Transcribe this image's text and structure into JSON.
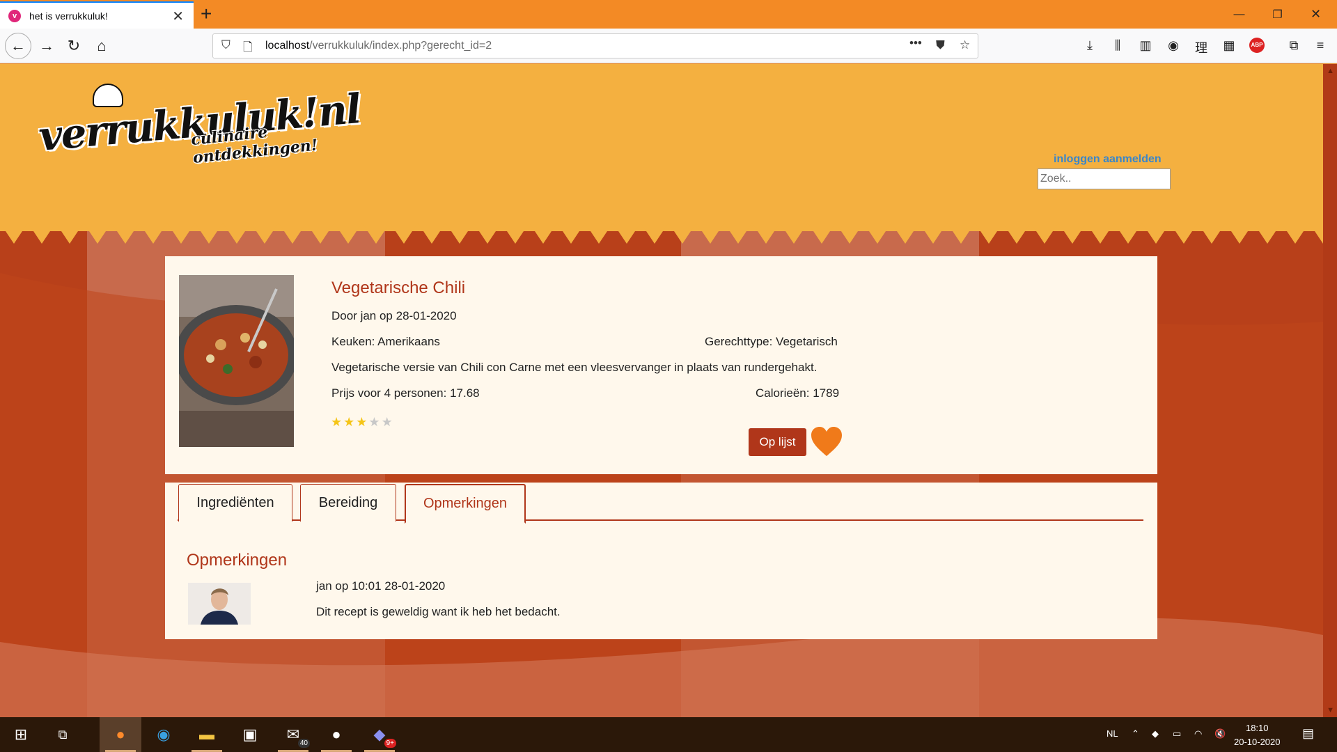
{
  "browser": {
    "tab_title": "het is verrukkuluk!",
    "url_host": "localhost",
    "url_path": "/verrukkuluk/index.php?gerecht_id=2"
  },
  "site": {
    "logo_text": "verrukkuluk!nl",
    "logo_subtitle": "culinaire ontdekkingen!",
    "auth_links": "inloggen aanmelden",
    "search_placeholder": "Zoek.."
  },
  "recipe": {
    "title": "Vegetarische Chili",
    "author_line": "Door jan op 28-01-2020",
    "kitchen": "Keuken: Amerikaans",
    "dish_type": "Gerechttype: Vegetarisch",
    "description": "Vegetarische versie van Chili con Carne met een vleesvervanger in plaats van rundergehakt.",
    "price": "Prijs voor 4 personen: 17.68",
    "calories": "Calorieën: 1789",
    "rating": 3,
    "rating_max": 5,
    "list_button": "Op lijst",
    "accent_color": "#b0361a",
    "heart_color": "#f07a1a"
  },
  "tabs": [
    {
      "label": "Ingrediënten"
    },
    {
      "label": "Bereiding"
    },
    {
      "label": "Opmerkingen",
      "active": true
    }
  ],
  "comments_section": {
    "title": "Opmerkingen",
    "comments": [
      {
        "meta": "jan op 10:01 28-01-2020",
        "text": "Dit recept is geweldig want ik heb het bedacht."
      }
    ]
  },
  "taskbar": {
    "mail_badge": "40",
    "discord_badge": "9+",
    "language": "NL",
    "time": "18:10",
    "date": "20-10-2020"
  }
}
